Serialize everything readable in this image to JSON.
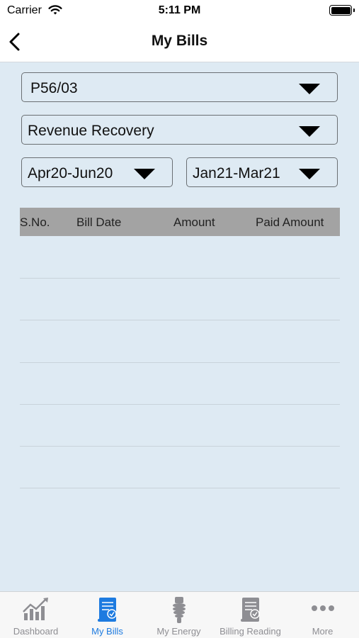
{
  "status_bar": {
    "carrier": "Carrier",
    "time": "5:11 PM"
  },
  "nav": {
    "title": "My Bills"
  },
  "filters": {
    "account": "P56/03",
    "bill_type": "Revenue Recovery",
    "from_period": "Apr20-Jun20",
    "to_period": "Jan21-Mar21"
  },
  "table": {
    "headers": [
      "S.No.",
      "Bill Date",
      "Amount",
      "Paid Amount"
    ],
    "rows": []
  },
  "tab_bar": {
    "active": "My Bills",
    "tabs": [
      {
        "label": "Dashboard",
        "icon": "chart-icon"
      },
      {
        "label": "My Bills",
        "icon": "bill-icon"
      },
      {
        "label": "My Energy",
        "icon": "bulb-icon"
      },
      {
        "label": "Billing Reading",
        "icon": "reading-icon"
      },
      {
        "label": "More",
        "icon": "more-icon"
      }
    ]
  },
  "colors": {
    "accent": "#1e7be0",
    "content_bg": "#deeaf3",
    "table_header_bg": "#a3a3a3",
    "inactive_tab": "#8e8e93"
  }
}
